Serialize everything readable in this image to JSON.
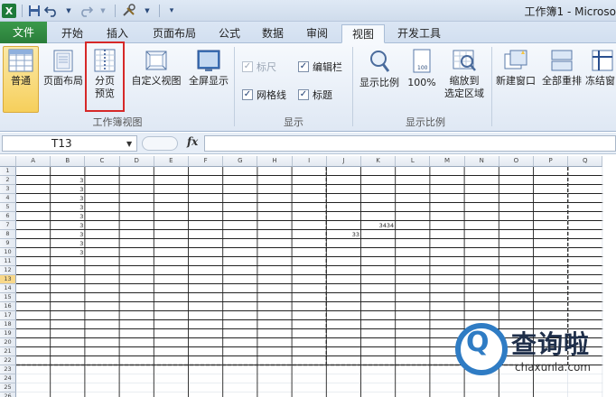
{
  "window": {
    "title": "工作簿1 - Microso"
  },
  "qat": {
    "app_icon": "excel-logo",
    "icons": [
      "save-icon",
      "undo-icon",
      "redo-icon",
      "tools-icon",
      "customize-icon"
    ],
    "logo_letter": "X"
  },
  "tabs": [
    {
      "label": "文件"
    },
    {
      "label": "开始"
    },
    {
      "label": "插入"
    },
    {
      "label": "页面布局"
    },
    {
      "label": "公式"
    },
    {
      "label": "数据"
    },
    {
      "label": "审阅"
    },
    {
      "label": "视图"
    },
    {
      "label": "开发工具"
    }
  ],
  "active_tab": "视图",
  "ribbon": {
    "workbook_views": {
      "group_label": "工作簿视图",
      "normal": "普通",
      "page_layout": "页面布局",
      "page_break_preview_line1": "分页",
      "page_break_preview_line2": "预览",
      "custom_views": "自定义视图",
      "full_screen": "全屏显示"
    },
    "show": {
      "group_label": "显示",
      "ruler": "标尺",
      "formula_bar": "编辑栏",
      "gridlines": "网格线",
      "headings": "标题",
      "ruler_checked": true,
      "formula_bar_checked": true,
      "gridlines_checked": true,
      "headings_checked": true,
      "check_mark": "✓"
    },
    "zoom": {
      "group_label": "显示比例",
      "zoom": "显示比例",
      "hundred": "100%",
      "zoom_to_selection_line1": "缩放到",
      "zoom_to_selection_line2": "选定区域",
      "hundred_badge": "100"
    },
    "window": {
      "new_window": "新建窗口",
      "arrange_all": "全部重排",
      "freeze_panes": "冻结窗"
    }
  },
  "formula_bar": {
    "name_box": "T13",
    "fx": "fx",
    "formula": ""
  },
  "sheet": {
    "columns": [
      "A",
      "B",
      "C",
      "D",
      "E",
      "F",
      "G",
      "H",
      "I",
      "J",
      "K",
      "L",
      "M",
      "N",
      "O",
      "P",
      "Q"
    ],
    "rows": [
      "1",
      "2",
      "3",
      "4",
      "5",
      "6",
      "7",
      "8",
      "9",
      "10",
      "11",
      "12",
      "13",
      "14",
      "15",
      "16",
      "17",
      "18",
      "19",
      "20",
      "21",
      "22",
      "23",
      "24",
      "25",
      "26"
    ],
    "selected_row": "13",
    "cells": [
      {
        "ref": "B2",
        "value": "3"
      },
      {
        "ref": "B3",
        "value": "3"
      },
      {
        "ref": "B4",
        "value": "3"
      },
      {
        "ref": "B5",
        "value": "3"
      },
      {
        "ref": "B6",
        "value": "3"
      },
      {
        "ref": "B7",
        "value": "3"
      },
      {
        "ref": "B8",
        "value": "3"
      },
      {
        "ref": "B9",
        "value": "3"
      },
      {
        "ref": "B10",
        "value": "3"
      },
      {
        "ref": "K7",
        "value": "3434"
      },
      {
        "ref": "J8",
        "value": "33"
      }
    ]
  },
  "watermark": {
    "chinese": "查询啦",
    "english": "chaxunla.com",
    "glyph": "Q"
  },
  "colors": {
    "file_tab": "#2a7d3a",
    "highlight_box": "#d62828",
    "selected_button": "#f6cf5b",
    "watermark_blue": "#2f7cc4"
  }
}
